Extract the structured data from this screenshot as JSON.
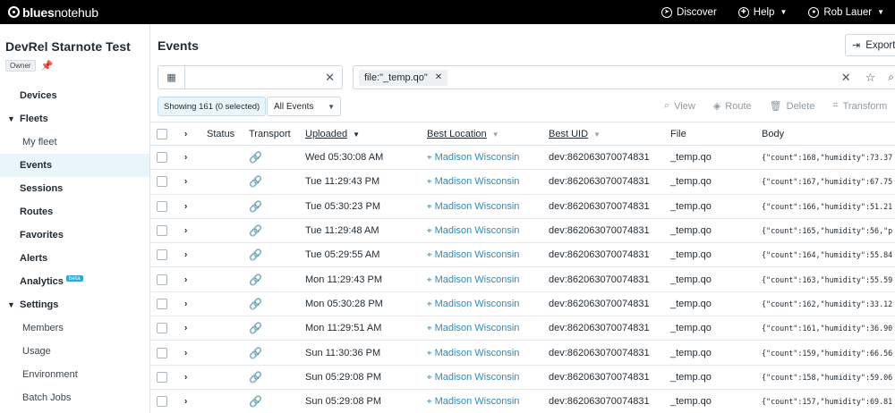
{
  "topbar": {
    "brand_bold": "blues",
    "brand_light": "notehub",
    "nav": [
      {
        "label": "Discover",
        "icon": "compass-icon",
        "dropdown": false
      },
      {
        "label": "Help",
        "icon": "globe-icon",
        "dropdown": true
      },
      {
        "label": "Rob Lauer",
        "icon": "user-icon",
        "dropdown": true
      }
    ]
  },
  "sidebar": {
    "project": "DevRel Starnote Test",
    "owner_badge": "Owner",
    "items": [
      {
        "label": "Devices",
        "type": "top"
      },
      {
        "label": "Fleets",
        "type": "group"
      },
      {
        "label": "My fleet",
        "type": "child"
      },
      {
        "label": "Events",
        "type": "active"
      },
      {
        "label": "Sessions",
        "type": "top"
      },
      {
        "label": "Routes",
        "type": "top"
      },
      {
        "label": "Favorites",
        "type": "top"
      },
      {
        "label": "Alerts",
        "type": "top"
      },
      {
        "label": "Analytics",
        "type": "top",
        "badge": "beta"
      },
      {
        "label": "Settings",
        "type": "group"
      },
      {
        "label": "Members",
        "type": "child"
      },
      {
        "label": "Usage",
        "type": "child"
      },
      {
        "label": "Environment",
        "type": "child"
      },
      {
        "label": "Batch Jobs",
        "type": "child"
      }
    ]
  },
  "main": {
    "title": "Events",
    "export_label": "Export",
    "filter_chip": "file:\"_temp.qo\"",
    "showing": "Showing 161 (0 selected)",
    "events_select": "All Events",
    "actions": [
      {
        "label": "View",
        "icon": "search-icon"
      },
      {
        "label": "Route",
        "icon": "route-icon"
      },
      {
        "label": "Delete",
        "icon": "trash-icon"
      },
      {
        "label": "Transform",
        "icon": "transform-icon"
      }
    ]
  },
  "table": {
    "columns": {
      "status": "Status",
      "transport": "Transport",
      "uploaded": "Uploaded",
      "best_location": "Best Location",
      "best_uid": "Best UID",
      "file": "File",
      "body": "Body"
    },
    "rows": [
      {
        "uploaded": "Wed 05:30:08 AM",
        "location": "Madison Wisconsin",
        "uid": "dev:862063070074831",
        "file": "_temp.qo",
        "body": "{\"count\":168,\"humidity\":73.37"
      },
      {
        "uploaded": "Tue 11:29:43 PM",
        "location": "Madison Wisconsin",
        "uid": "dev:862063070074831",
        "file": "_temp.qo",
        "body": "{\"count\":167,\"humidity\":67.75"
      },
      {
        "uploaded": "Tue 05:30:23 PM",
        "location": "Madison Wisconsin",
        "uid": "dev:862063070074831",
        "file": "_temp.qo",
        "body": "{\"count\":166,\"humidity\":51.21"
      },
      {
        "uploaded": "Tue 11:29:48 AM",
        "location": "Madison Wisconsin",
        "uid": "dev:862063070074831",
        "file": "_temp.qo",
        "body": "{\"count\":165,\"humidity\":56,\"p"
      },
      {
        "uploaded": "Tue 05:29:55 AM",
        "location": "Madison Wisconsin",
        "uid": "dev:862063070074831",
        "file": "_temp.qo",
        "body": "{\"count\":164,\"humidity\":55.84"
      },
      {
        "uploaded": "Mon 11:29:43 PM",
        "location": "Madison Wisconsin",
        "uid": "dev:862063070074831",
        "file": "_temp.qo",
        "body": "{\"count\":163,\"humidity\":55.59"
      },
      {
        "uploaded": "Mon 05:30:28 PM",
        "location": "Madison Wisconsin",
        "uid": "dev:862063070074831",
        "file": "_temp.qo",
        "body": "{\"count\":162,\"humidity\":33.12"
      },
      {
        "uploaded": "Mon 11:29:51 AM",
        "location": "Madison Wisconsin",
        "uid": "dev:862063070074831",
        "file": "_temp.qo",
        "body": "{\"count\":161,\"humidity\":36.90"
      },
      {
        "uploaded": "Sun 11:30:36 PM",
        "location": "Madison Wisconsin",
        "uid": "dev:862063070074831",
        "file": "_temp.qo",
        "body": "{\"count\":159,\"humidity\":66.56"
      },
      {
        "uploaded": "Sun 05:29:08 PM",
        "location": "Madison Wisconsin",
        "uid": "dev:862063070074831",
        "file": "_temp.qo",
        "body": "{\"count\":158,\"humidity\":59.06"
      },
      {
        "uploaded": "Sun 05:29:08 PM",
        "location": "Madison Wisconsin",
        "uid": "dev:862063070074831",
        "file": "_temp.qo",
        "body": "{\"count\":157,\"humidity\":69.81"
      }
    ]
  }
}
